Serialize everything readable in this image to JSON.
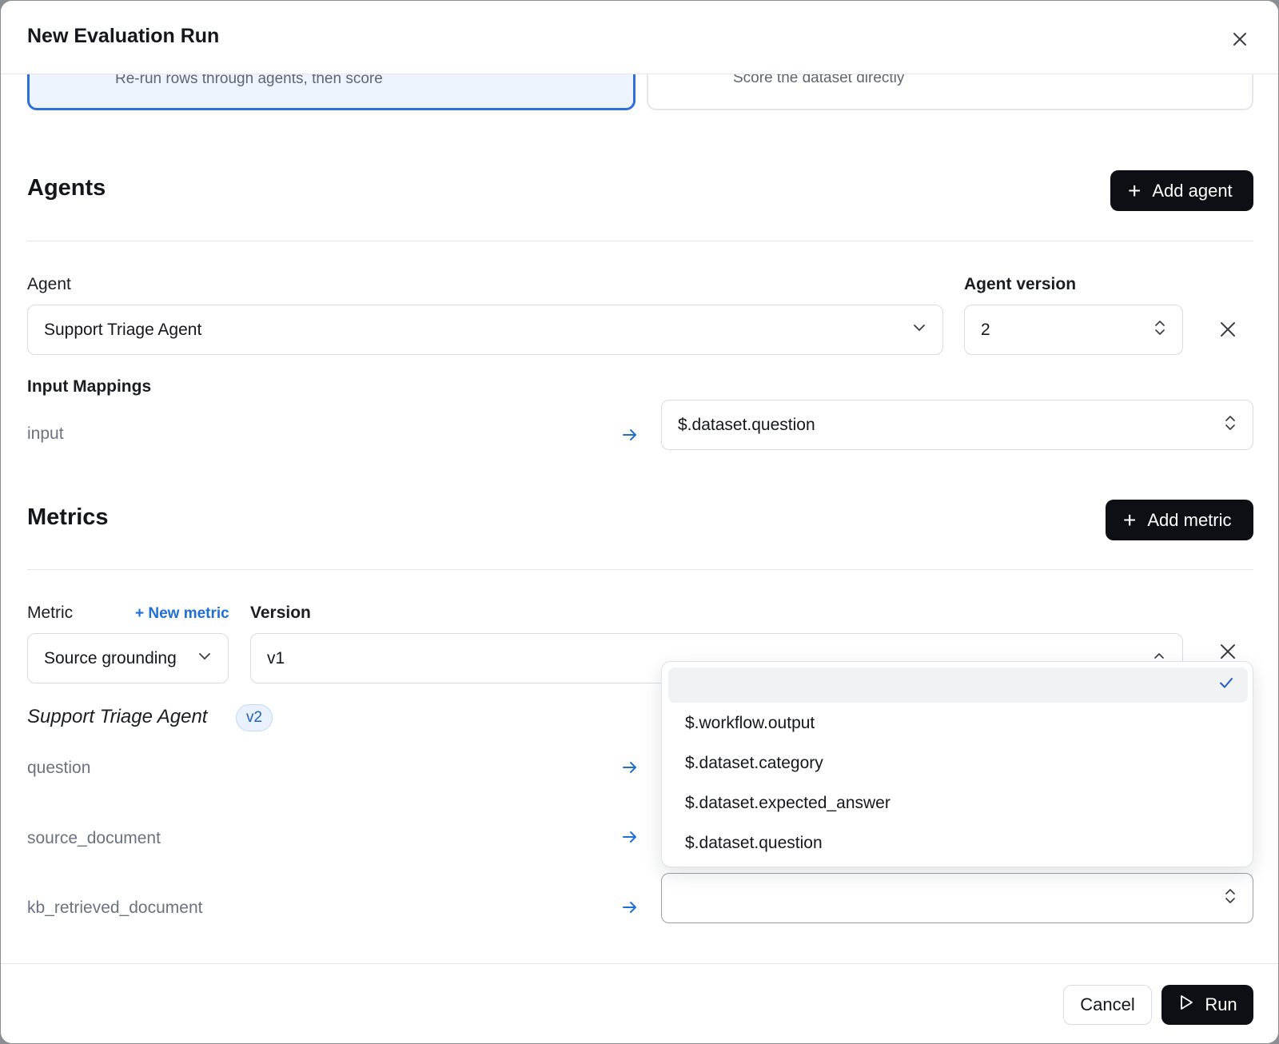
{
  "dialog": {
    "title": "New Evaluation Run",
    "close_icon": "close-icon"
  },
  "mode_cards": [
    {
      "description": "Re-run rows through agents, then score",
      "selected": true
    },
    {
      "description": "Score the dataset directly",
      "selected": false
    }
  ],
  "agents": {
    "section_title": "Agents",
    "add_button_label": "Add agent",
    "agent_label": "Agent",
    "agent_value": "Support Triage Agent",
    "version_label": "Agent version",
    "version_value": "2",
    "input_mappings_label": "Input Mappings",
    "mappings": [
      {
        "key": "input",
        "value": "$.dataset.question"
      }
    ]
  },
  "metrics": {
    "section_title": "Metrics",
    "add_button_label": "Add metric",
    "metric_label": "Metric",
    "new_metric_link": "+ New metric",
    "version_label": "Version",
    "metric_value": "Source grounding",
    "version_value": "v1",
    "agent_name": "Support Triage Agent",
    "agent_version_badge": "v2",
    "mappings": [
      {
        "key": "question"
      },
      {
        "key": "source_document"
      },
      {
        "key": "kb_retrieved_document",
        "value": ""
      }
    ]
  },
  "dropdown": {
    "options": [
      {
        "label": "",
        "selected": true
      },
      {
        "label": "$.workflow.output"
      },
      {
        "label": "$.dataset.category"
      },
      {
        "label": "$.dataset.expected_answer"
      },
      {
        "label": "$.dataset.question"
      }
    ]
  },
  "footer": {
    "cancel_label": "Cancel",
    "run_label": "Run"
  },
  "colors": {
    "accent": "#1f6fd6",
    "selected_card_border": "#2f6fdc",
    "primary_button": "#0d0f14"
  }
}
